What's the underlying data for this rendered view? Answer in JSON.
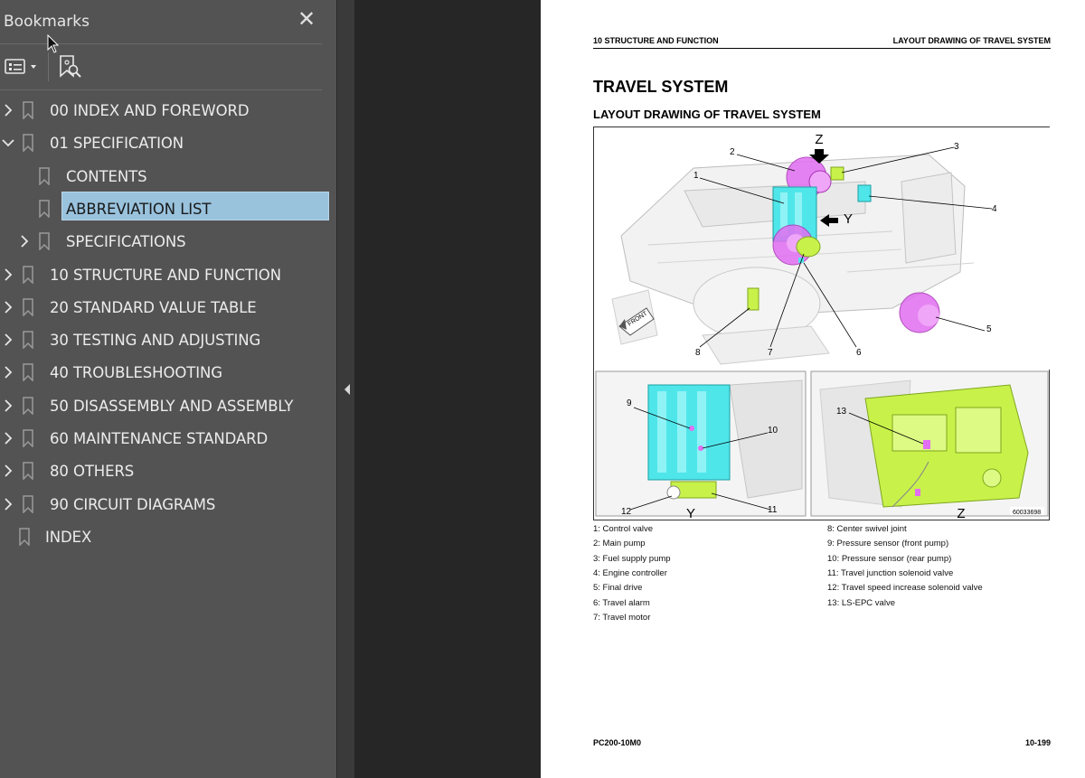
{
  "panel": {
    "title": "Bookmarks",
    "close_glyph": "✕",
    "items": [
      {
        "label": "00 INDEX AND FOREWORD",
        "caret": "right"
      },
      {
        "label": "01 SPECIFICATION",
        "caret": "down"
      },
      {
        "label": "CONTENTS",
        "caret": "none"
      },
      {
        "label": "ABBREVIATION LIST",
        "caret": "none",
        "selected": true
      },
      {
        "label": "SPECIFICATIONS",
        "caret": "right"
      },
      {
        "label": "10 STRUCTURE AND FUNCTION",
        "caret": "right"
      },
      {
        "label": "20 STANDARD VALUE TABLE",
        "caret": "right"
      },
      {
        "label": "30 TESTING AND ADJUSTING",
        "caret": "right"
      },
      {
        "label": "40 TROUBLESHOOTING",
        "caret": "right"
      },
      {
        "label": "50 DISASSEMBLY AND ASSEMBLY",
        "caret": "right"
      },
      {
        "label": "60 MAINTENANCE STANDARD",
        "caret": "right"
      },
      {
        "label": "80 OTHERS",
        "caret": "right"
      },
      {
        "label": "90 CIRCUIT DIAGRAMS",
        "caret": "right"
      },
      {
        "label": "INDEX",
        "caret": "none"
      }
    ]
  },
  "page": {
    "header_left": "10 STRUCTURE AND FUNCTION",
    "header_right": "LAYOUT DRAWING OF TRAVEL SYSTEM",
    "title": "TRAVEL SYSTEM",
    "subtitle": "LAYOUT DRAWING OF TRAVEL SYSTEM",
    "figure": {
      "view_labels": {
        "z": "Z",
        "y": "Y"
      },
      "callouts": [
        "1",
        "2",
        "3",
        "4",
        "5",
        "6",
        "7",
        "8",
        "9",
        "10",
        "11",
        "12",
        "13"
      ],
      "front_tag": "FRONT",
      "figure_id": "60033698"
    },
    "legend_left": [
      "1: Control valve",
      "2: Main pump",
      "3: Fuel supply pump",
      "4: Engine controller",
      "5: Final drive",
      "6: Travel alarm",
      "7: Travel motor"
    ],
    "legend_right": [
      "8: Center swivel joint",
      "9: Pressure sensor (front pump)",
      "10: Pressure sensor (rear pump)",
      "11: Travel junction solenoid valve",
      "12: Travel speed increase solenoid valve",
      "13: LS-EPC valve"
    ],
    "footer_left": "PC200-10M0",
    "footer_right": "10-199"
  },
  "colors": {
    "panel_bg": "#535353",
    "selection": "#99c2dd",
    "viewer_bg": "#262626",
    "highlight_magenta": "#e26ef2",
    "highlight_cyan": "#4fe6ea",
    "highlight_green": "#c8f24a"
  }
}
